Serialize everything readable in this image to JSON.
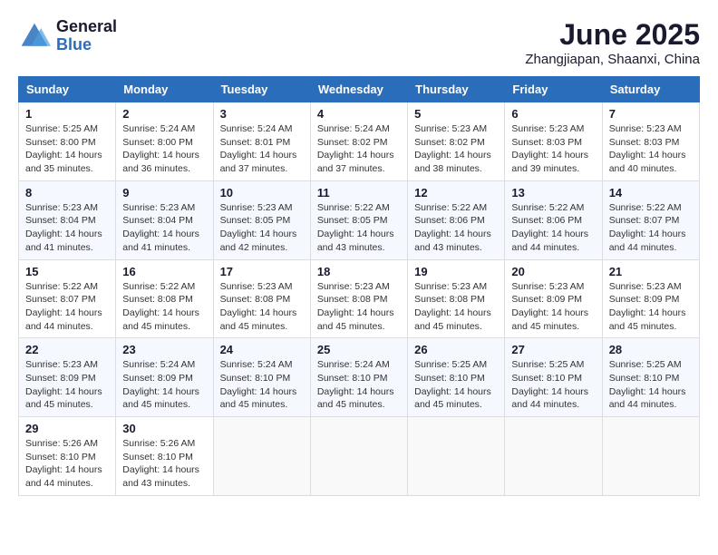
{
  "logo": {
    "general": "General",
    "blue": "Blue"
  },
  "title": "June 2025",
  "subtitle": "Zhangjiapan, Shaanxi, China",
  "weekdays": [
    "Sunday",
    "Monday",
    "Tuesday",
    "Wednesday",
    "Thursday",
    "Friday",
    "Saturday"
  ],
  "weeks": [
    [
      {
        "day": 1,
        "sunrise": "5:25 AM",
        "sunset": "8:00 PM",
        "daylight": "14 hours and 35 minutes."
      },
      {
        "day": 2,
        "sunrise": "5:24 AM",
        "sunset": "8:00 PM",
        "daylight": "14 hours and 36 minutes."
      },
      {
        "day": 3,
        "sunrise": "5:24 AM",
        "sunset": "8:01 PM",
        "daylight": "14 hours and 37 minutes."
      },
      {
        "day": 4,
        "sunrise": "5:24 AM",
        "sunset": "8:02 PM",
        "daylight": "14 hours and 37 minutes."
      },
      {
        "day": 5,
        "sunrise": "5:23 AM",
        "sunset": "8:02 PM",
        "daylight": "14 hours and 38 minutes."
      },
      {
        "day": 6,
        "sunrise": "5:23 AM",
        "sunset": "8:03 PM",
        "daylight": "14 hours and 39 minutes."
      },
      {
        "day": 7,
        "sunrise": "5:23 AM",
        "sunset": "8:03 PM",
        "daylight": "14 hours and 40 minutes."
      }
    ],
    [
      {
        "day": 8,
        "sunrise": "5:23 AM",
        "sunset": "8:04 PM",
        "daylight": "14 hours and 41 minutes."
      },
      {
        "day": 9,
        "sunrise": "5:23 AM",
        "sunset": "8:04 PM",
        "daylight": "14 hours and 41 minutes."
      },
      {
        "day": 10,
        "sunrise": "5:23 AM",
        "sunset": "8:05 PM",
        "daylight": "14 hours and 42 minutes."
      },
      {
        "day": 11,
        "sunrise": "5:22 AM",
        "sunset": "8:05 PM",
        "daylight": "14 hours and 43 minutes."
      },
      {
        "day": 12,
        "sunrise": "5:22 AM",
        "sunset": "8:06 PM",
        "daylight": "14 hours and 43 minutes."
      },
      {
        "day": 13,
        "sunrise": "5:22 AM",
        "sunset": "8:06 PM",
        "daylight": "14 hours and 44 minutes."
      },
      {
        "day": 14,
        "sunrise": "5:22 AM",
        "sunset": "8:07 PM",
        "daylight": "14 hours and 44 minutes."
      }
    ],
    [
      {
        "day": 15,
        "sunrise": "5:22 AM",
        "sunset": "8:07 PM",
        "daylight": "14 hours and 44 minutes."
      },
      {
        "day": 16,
        "sunrise": "5:22 AM",
        "sunset": "8:08 PM",
        "daylight": "14 hours and 45 minutes."
      },
      {
        "day": 17,
        "sunrise": "5:23 AM",
        "sunset": "8:08 PM",
        "daylight": "14 hours and 45 minutes."
      },
      {
        "day": 18,
        "sunrise": "5:23 AM",
        "sunset": "8:08 PM",
        "daylight": "14 hours and 45 minutes."
      },
      {
        "day": 19,
        "sunrise": "5:23 AM",
        "sunset": "8:08 PM",
        "daylight": "14 hours and 45 minutes."
      },
      {
        "day": 20,
        "sunrise": "5:23 AM",
        "sunset": "8:09 PM",
        "daylight": "14 hours and 45 minutes."
      },
      {
        "day": 21,
        "sunrise": "5:23 AM",
        "sunset": "8:09 PM",
        "daylight": "14 hours and 45 minutes."
      }
    ],
    [
      {
        "day": 22,
        "sunrise": "5:23 AM",
        "sunset": "8:09 PM",
        "daylight": "14 hours and 45 minutes."
      },
      {
        "day": 23,
        "sunrise": "5:24 AM",
        "sunset": "8:09 PM",
        "daylight": "14 hours and 45 minutes."
      },
      {
        "day": 24,
        "sunrise": "5:24 AM",
        "sunset": "8:10 PM",
        "daylight": "14 hours and 45 minutes."
      },
      {
        "day": 25,
        "sunrise": "5:24 AM",
        "sunset": "8:10 PM",
        "daylight": "14 hours and 45 minutes."
      },
      {
        "day": 26,
        "sunrise": "5:25 AM",
        "sunset": "8:10 PM",
        "daylight": "14 hours and 45 minutes."
      },
      {
        "day": 27,
        "sunrise": "5:25 AM",
        "sunset": "8:10 PM",
        "daylight": "14 hours and 44 minutes."
      },
      {
        "day": 28,
        "sunrise": "5:25 AM",
        "sunset": "8:10 PM",
        "daylight": "14 hours and 44 minutes."
      }
    ],
    [
      {
        "day": 29,
        "sunrise": "5:26 AM",
        "sunset": "8:10 PM",
        "daylight": "14 hours and 44 minutes."
      },
      {
        "day": 30,
        "sunrise": "5:26 AM",
        "sunset": "8:10 PM",
        "daylight": "14 hours and 43 minutes."
      },
      null,
      null,
      null,
      null,
      null
    ]
  ]
}
